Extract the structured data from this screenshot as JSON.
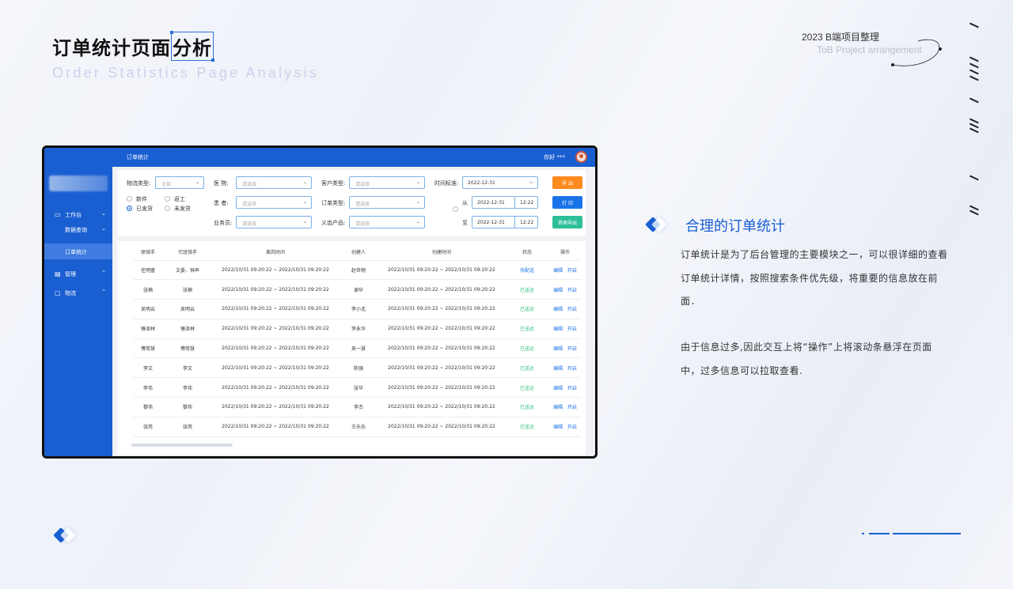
{
  "header": {
    "title_main": "订单统计页面",
    "title_highlight": "分析",
    "subtitle": "Order Statistics Page Analysis",
    "year_label": "2023  B端项目整理",
    "year_sub": "ToB Project arrangement"
  },
  "app": {
    "page_title": "订单统计",
    "greeting": "你好 ***",
    "sidebar": [
      {
        "icon": "monitor-icon",
        "label": "工作台",
        "chevron": "⌄"
      },
      {
        "icon": "",
        "label": "数据查询",
        "chevron": "⌄"
      },
      {
        "icon": "",
        "label": "订单统计",
        "chevron": ""
      },
      {
        "icon": "manage-icon",
        "label": "管理",
        "chevron": "⌃"
      },
      {
        "icon": "logistics-icon",
        "label": "物流",
        "chevron": "⌃"
      }
    ],
    "filters": {
      "logistics_type_label": "物流类型:",
      "logistics_type_value": "全部",
      "radio_options": [
        "新件",
        "返工",
        "已发货",
        "未发货"
      ],
      "hospital_label": "医    院:",
      "patient_label": "患    者:",
      "salesman_label": "业务员:",
      "customer_type_label": "客户类型:",
      "order_type_label": "订单类型:",
      "denture_label": "义齿产品:",
      "select_placeholder": "请选择",
      "time_standard_label": "时间标准:",
      "time_standard_value": "2022-12-31",
      "from_label": "从",
      "to_label": "至",
      "from_date": "2022-12-31",
      "from_time": "12:22",
      "to_date": "2022-12-31",
      "to_time": "12:22",
      "export_btn": "导 出",
      "print_btn": "打 印",
      "page_export_btn": "界面导出"
    },
    "table": {
      "columns": [
        "原骑手",
        "代班骑手",
        "离岗时间",
        "创建人",
        "创建时间",
        "状态",
        "操作"
      ],
      "edit_label": "编辑",
      "enable_label": "开启",
      "rows": [
        {
          "rider": "任明盛",
          "sub": "文委、钟声",
          "leave": "2022/10/31 09:20:22 ~ 2022/10/31 09:20:22",
          "creator": "赵世翔",
          "created": "2022/10/31 09:20:22 ~ 2022/10/31 09:20:22",
          "status": "待配送",
          "pending": true
        },
        {
          "rider": "张楠",
          "sub": "张楠",
          "leave": "2022/10/31 09:20:22 ~ 2022/10/31 09:20:22",
          "creator": "谢华",
          "created": "2022/10/31 09:20:22 ~ 2022/10/31 09:20:22",
          "status": "已送达",
          "pending": false
        },
        {
          "rider": "吴明云",
          "sub": "吴明云",
          "leave": "2022/10/31 09:20:22 ~ 2022/10/31 09:20:22",
          "creator": "李小北",
          "created": "2022/10/31 09:20:22 ~ 2022/10/31 09:20:22",
          "status": "已送达",
          "pending": false
        },
        {
          "rider": "锤泽林",
          "sub": "锤泽林",
          "leave": "2022/10/31 09:20:22 ~ 2022/10/31 09:20:22",
          "creator": "李永华",
          "created": "2022/10/31 09:20:22 ~ 2022/10/31 09:20:22",
          "status": "已送达",
          "pending": false
        },
        {
          "rider": "傅常慧",
          "sub": "傅常慧",
          "leave": "2022/10/31 09:20:22 ~ 2022/10/31 09:20:22",
          "creator": "吴一慧",
          "created": "2022/10/31 09:20:22 ~ 2022/10/31 09:20:22",
          "status": "已送达",
          "pending": false
        },
        {
          "rider": "李文",
          "sub": "李文",
          "leave": "2022/10/31 09:20:22 ~ 2022/10/31 09:20:22",
          "creator": "陈强",
          "created": "2022/10/31 09:20:22 ~ 2022/10/31 09:20:22",
          "status": "已送达",
          "pending": false
        },
        {
          "rider": "李伟",
          "sub": "李伟",
          "leave": "2022/10/31 09:20:22 ~ 2022/10/31 09:20:22",
          "creator": "张华",
          "created": "2022/10/31 09:20:22 ~ 2022/10/31 09:20:22",
          "status": "已送达",
          "pending": false
        },
        {
          "rider": "黎伟",
          "sub": "黎伟",
          "leave": "2022/10/31 09:20:22 ~ 2022/10/31 09:20:22",
          "creator": "李杰",
          "created": "2022/10/31 09:20:22 ~ 2022/10/31 09:20:22",
          "status": "已送达",
          "pending": false
        },
        {
          "rider": "张芮",
          "sub": "张芮",
          "leave": "2022/10/31 09:20:22 ~ 2022/10/31 09:20:22",
          "creator": "王乐乐",
          "created": "2022/10/31 09:20:22 ~ 2022/10/31 09:20:22",
          "status": "已送达",
          "pending": false
        }
      ]
    }
  },
  "section": {
    "title": "合理的订单统计",
    "para1": "订单统计是为了后台管理的主要模块之一，可以很详细的查看订单统计详情，按照搜索条件优先级，将重要的信息放在前面．",
    "para2": "由于信息过多,因此交互上将“操作”上将滚动条悬浮在页面中，过多信息可以拉取查看."
  },
  "colors": {
    "brand": "#1a5fd1",
    "orange": "#ff8a1f",
    "green": "#2dbf7c"
  }
}
